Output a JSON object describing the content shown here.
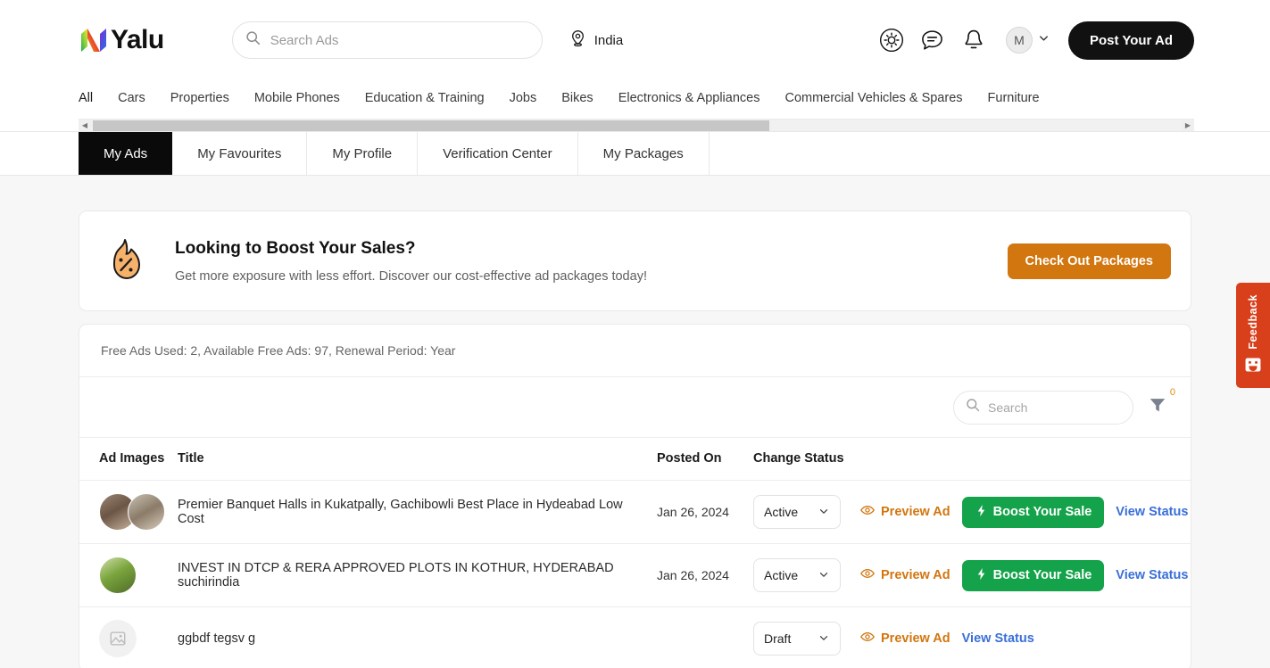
{
  "header": {
    "brand": "Yalu",
    "logo_icon": "yalu-logo-icon",
    "search": {
      "placeholder": "Search Ads",
      "value": ""
    },
    "location": {
      "label": "India",
      "icon": "location-pin-icon"
    },
    "icons": [
      {
        "name": "theme-sun-icon",
        "label": "Theme"
      },
      {
        "name": "chat-icon",
        "label": "Messages"
      },
      {
        "name": "bell-icon",
        "label": "Notifications"
      }
    ],
    "avatar": {
      "initial": "M",
      "chevron": "chevron-down-icon"
    },
    "post_ad_label": "Post Your Ad"
  },
  "categories": [
    "All",
    "Cars",
    "Properties",
    "Mobile Phones",
    "Education & Training",
    "Jobs",
    "Bikes",
    "Electronics & Appliances",
    "Commercial Vehicles & Spares",
    "Furniture"
  ],
  "tabs": [
    {
      "label": "My Ads",
      "active": true
    },
    {
      "label": "My Favourites",
      "active": false
    },
    {
      "label": "My Profile",
      "active": false
    },
    {
      "label": "Verification Center",
      "active": false
    },
    {
      "label": "My Packages",
      "active": false
    }
  ],
  "promo": {
    "icon": "discount-flame-icon",
    "title": "Looking to Boost Your Sales?",
    "subtitle": "Get more exposure with less effort. Discover our cost-effective ad packages today!",
    "button_label": "Check Out Packages",
    "button_color": "#d2760f"
  },
  "free_ads_info": "Free Ads Used: 2, Available Free Ads: 97, Renewal Period: Year",
  "toolbar": {
    "search": {
      "placeholder": "Search",
      "value": "",
      "icon": "search-icon"
    },
    "filter": {
      "icon": "filter-funnel-icon",
      "badge": "0",
      "badge_color": "#e08b12"
    }
  },
  "table": {
    "columns": [
      "Ad Images",
      "Title",
      "Posted On",
      "Change Status"
    ],
    "rows": [
      {
        "thumbnails": 2,
        "thumbnail_kind": "photo",
        "title": "Premier Banquet Halls in Kukatpally, Gachibowli Best Place in Hydeabad Low Cost",
        "posted_on": "Jan 26, 2024",
        "status": "Active",
        "preview_label": "Preview Ad",
        "boost_label": "Boost Your Sale",
        "view_status_label": "View Status",
        "has_boost": true
      },
      {
        "thumbnails": 1,
        "thumbnail_kind": "photo",
        "title": "INVEST IN DTCP & RERA APPROVED PLOTS IN KOTHUR, HYDERABAD suchirindia",
        "posted_on": "Jan 26, 2024",
        "status": "Active",
        "preview_label": "Preview Ad",
        "boost_label": "Boost Your Sale",
        "view_status_label": "View Status",
        "has_boost": true
      },
      {
        "thumbnails": 1,
        "thumbnail_kind": "placeholder",
        "title": "ggbdf tegsv g",
        "posted_on": "",
        "status": "Draft",
        "preview_label": "Preview Ad",
        "boost_label": "",
        "view_status_label": "View Status",
        "has_boost": false
      }
    ]
  },
  "feedback": {
    "label": "Feedback",
    "icon": "smiley-face-icon",
    "color": "#d8401c"
  },
  "scrollbar": {
    "left_arrow": "◀",
    "right_arrow": "▶"
  }
}
